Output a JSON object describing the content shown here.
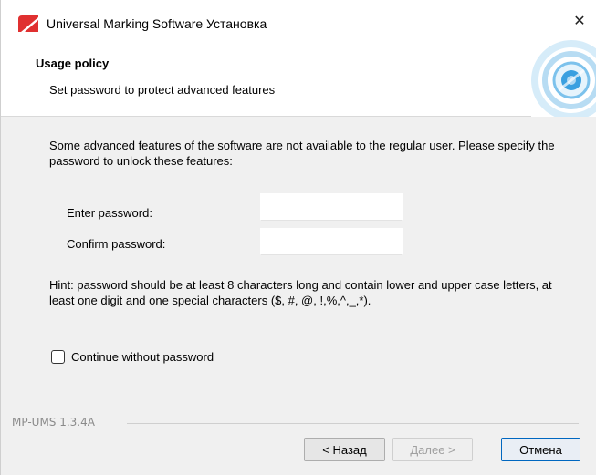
{
  "window": {
    "title": "Universal Marking Software Установка",
    "close_glyph": "✕",
    "app_icon": "red-slash-logo-icon"
  },
  "header": {
    "title": "Usage policy",
    "subtitle": "Set password to protect advanced features",
    "graphic": "blue-target-graphic"
  },
  "content": {
    "description": "Some advanced features of the software are not available to the regular user. Please specify the password to unlock these features:",
    "password_label": "Enter password:",
    "password_value": "",
    "confirm_label": "Confirm password:",
    "confirm_value": "",
    "hint": "Hint: password should be at least 8 characters long and contain lower and upper case letters, at least one digit and one special characters ($, #, @, !,%,^,_,*).",
    "checkbox_label": "Continue without password",
    "checkbox_checked": false
  },
  "footer": {
    "brand": "MP-UMS 1.3.4A",
    "back_label": "< Назад",
    "next_label": "Далее >",
    "cancel_label": "Отмена",
    "next_enabled": false
  },
  "colors": {
    "accent_red": "#e03030",
    "cancel_border": "#0067c0",
    "graphic_blue": "#3aa0e0"
  }
}
